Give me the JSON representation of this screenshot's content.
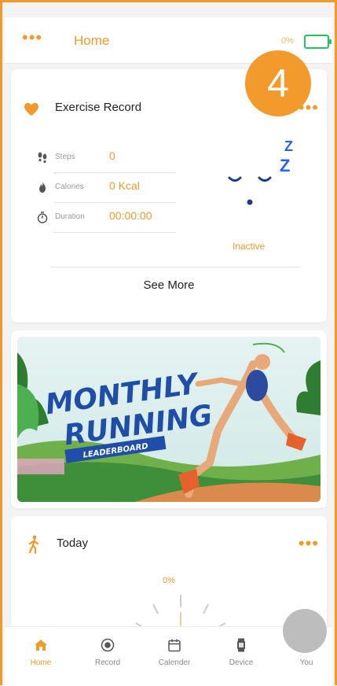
{
  "header": {
    "menu_icon": "more-dots-icon",
    "title": "Home",
    "battery_text": "0%",
    "battery_icon": "battery-icon"
  },
  "step_badge": "4",
  "exercise_record": {
    "title": "Exercise Record",
    "icon": "heart-icon",
    "rows": [
      {
        "icon": "footprints-icon",
        "label": "Steps",
        "value": "0"
      },
      {
        "icon": "flame-icon",
        "label": "Calories",
        "value": "0 Kcal"
      },
      {
        "icon": "stopwatch-icon",
        "label": "Duration",
        "value": "00:00:00"
      }
    ],
    "status": "Inactive",
    "sleep_z": [
      "Z",
      "Z"
    ],
    "see_more": "See More"
  },
  "banner": {
    "line1": "MONTHLY",
    "line2": "RUNNING",
    "tag": "LEADERBOARD"
  },
  "today": {
    "title": "Today",
    "icon": "walking-icon",
    "percent": "0%"
  },
  "tabs": [
    {
      "label": "Home",
      "icon": "home-icon",
      "active": true
    },
    {
      "label": "Record",
      "icon": "record-icon",
      "active": false
    },
    {
      "label": "Calender",
      "icon": "calendar-icon",
      "active": false
    },
    {
      "label": "Device",
      "icon": "watch-icon",
      "active": false
    },
    {
      "label": "You",
      "icon": "avatar",
      "active": false
    }
  ],
  "colors": {
    "accent": "#f39a2c",
    "battery": "#22c55e",
    "sleep_blue": "#2563eb"
  }
}
